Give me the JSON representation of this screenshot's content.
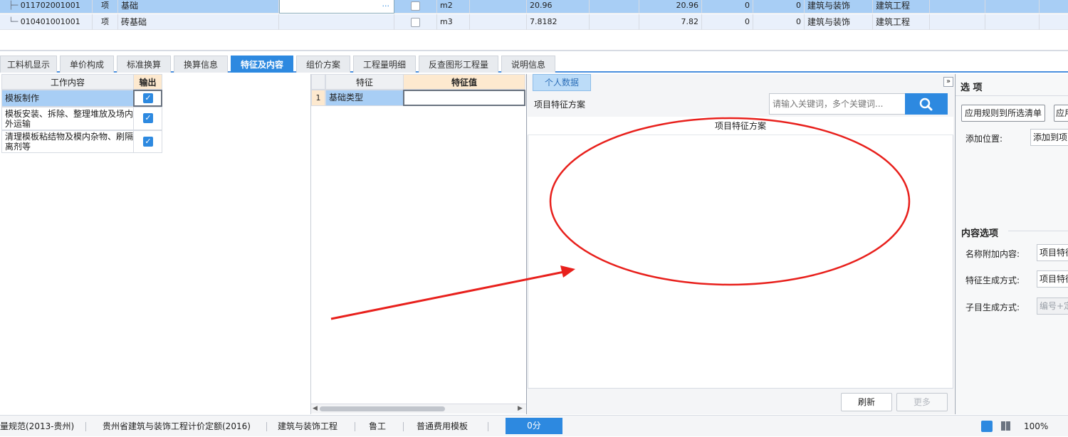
{
  "rows": [
    {
      "code": "011702001001",
      "type": "项",
      "name": "基础",
      "ellipsis": "···",
      "unit": "m2",
      "qty": "20.96",
      "qty2": "20.96",
      "v1": "0",
      "v2": "0",
      "cat": "建筑与装饰",
      "prof": "建筑工程"
    },
    {
      "code": "010401001001",
      "type": "项",
      "name": "砖基础",
      "ellipsis": "",
      "unit": "m3",
      "qty": "7.8182",
      "qty2": "7.82",
      "v1": "0",
      "v2": "0",
      "cat": "建筑与装饰",
      "prof": "建筑工程"
    }
  ],
  "tabs": [
    "工料机显示",
    "单价构成",
    "标准换算",
    "换算信息",
    "特征及内容",
    "组价方案",
    "工程量明细",
    "反查图形工程量",
    "说明信息"
  ],
  "active_tab": "特征及内容",
  "work": {
    "header_content": "工作内容",
    "header_output": "输出",
    "items": [
      "模板制作",
      "模板安装、拆除、整理堆放及场内外运输",
      "清理模板粘结物及模内杂物、刷隔离剂等"
    ]
  },
  "feature": {
    "header_feature": "特征",
    "header_value": "特征值",
    "rows": [
      {
        "index": "1",
        "name": "基础类型",
        "value": ""
      }
    ]
  },
  "scheme": {
    "personal_tab": "个人数据",
    "title": "项目特征方案",
    "search_placeholder": "请输入关键词，多个关键词...",
    "column": "项目特征方案",
    "refresh": "刷新",
    "more": "更多",
    "collapse": "»"
  },
  "options": {
    "title": "选 项",
    "apply_btn": "应用规则到所选清单",
    "apply_btn2": "应用",
    "add_pos_label": "添加位置:",
    "add_pos_value": "添加到项",
    "content_title": "内容选项",
    "name_label": "名称附加内容:",
    "name_value": "项目特征",
    "feature_label": "特征生成方式:",
    "feature_value": "项目特征",
    "child_label": "子目生成方式:",
    "child_value": "编号+定"
  },
  "status": {
    "items": [
      "量规范(2013-贵州)",
      "贵州省建筑与装饰工程计价定额(2016)",
      "建筑与装饰工程",
      "鲁工",
      "普通费用模板"
    ],
    "score": "0分",
    "zoom": "100%"
  },
  "colors": {
    "accent": "#2d89e0",
    "selected_row": "#a8cef5",
    "annotation": "#e8201c"
  }
}
